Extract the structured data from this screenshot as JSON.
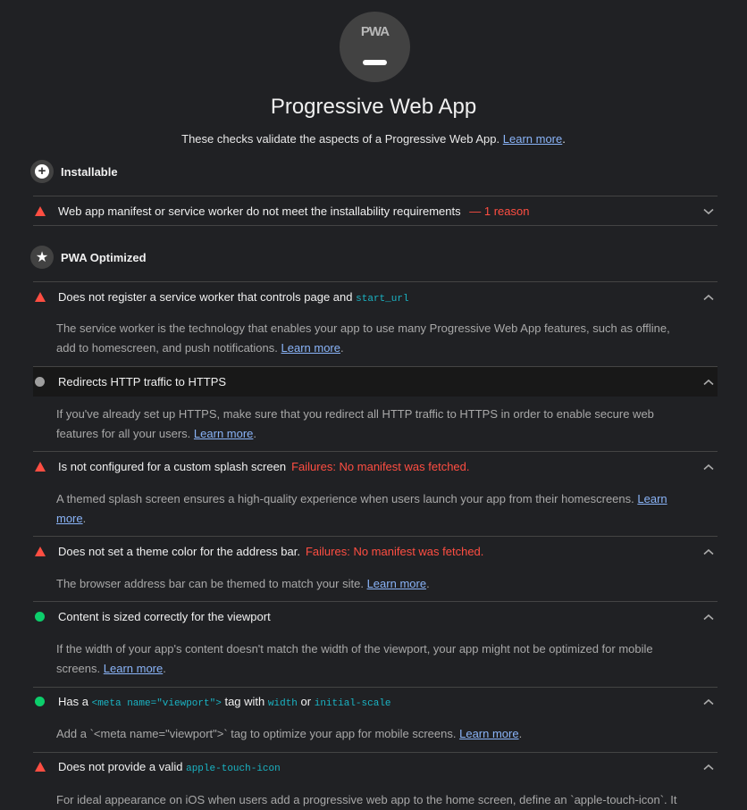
{
  "gauge": {
    "label": "PWA",
    "icon": "dash-icon"
  },
  "header": {
    "title": "Progressive Web App",
    "subtitle": "These checks validate the aspects of a Progressive Web App.",
    "learn_more": "Learn more",
    "period": "."
  },
  "groups": [
    {
      "title": "Installable",
      "icon": "plus-circle-icon",
      "audits": [
        {
          "status": "fail",
          "label": "Web app manifest or service worker do not meet the installability requirements",
          "extra": "— 1 reason",
          "expanded": false
        }
      ]
    },
    {
      "title": "PWA Optimized",
      "icon": "star-icon",
      "audits": [
        {
          "status": "fail",
          "label": "Does not register a service worker that controls page and",
          "code": "start_url",
          "expanded": true,
          "description": "The service worker is the technology that enables your app to use many Progressive Web App features, such as offline, add to homescreen, and push notifications.",
          "learn_more": "Learn more"
        },
        {
          "status": "manual",
          "label": "Redirects HTTP traffic to HTTPS",
          "expanded": true,
          "description": "If you've already set up HTTPS, make sure that you redirect all HTTP traffic to HTTPS in order to enable secure web features for all your users.",
          "learn_more": "Learn more"
        },
        {
          "status": "fail",
          "label": "Is not configured for a custom splash screen",
          "failure": "Failures: No manifest was fetched.",
          "expanded": true,
          "description": "A themed splash screen ensures a high-quality experience when users launch your app from their homescreens.",
          "learn_more": "Learn more"
        },
        {
          "status": "fail",
          "label": "Does not set a theme color for the address bar.",
          "failure": "Failures: No manifest was fetched.",
          "expanded": true,
          "description": "The browser address bar can be themed to match your site.",
          "learn_more": "Learn more"
        },
        {
          "status": "pass",
          "label": "Content is sized correctly for the viewport",
          "expanded": true,
          "description": "If the width of your app's content doesn't match the width of the viewport, your app might not be optimized for mobile screens.",
          "learn_more": "Learn more"
        },
        {
          "status": "pass",
          "label_parts": [
            "Has a",
            "<meta name=\"viewport\">",
            "tag with",
            "width",
            "or",
            "initial-scale"
          ],
          "expanded": true,
          "description": "Add a `<meta name=\"viewport\">` tag to optimize your app for mobile screens.",
          "learn_more": "Learn more"
        },
        {
          "status": "fail",
          "label": "Does not provide a valid",
          "code": "apple-touch-icon",
          "expanded": true,
          "description": "For ideal appearance on iOS when users add a progressive web app to the home screen, define an `apple-touch-icon`. It"
        }
      ]
    }
  ],
  "colors": {
    "fail": "#ff4e42",
    "pass": "#0cce6b",
    "manual": "#9e9e9e",
    "link": "#8ab4f8",
    "code": "#1ab4c4",
    "background": "#202124"
  }
}
